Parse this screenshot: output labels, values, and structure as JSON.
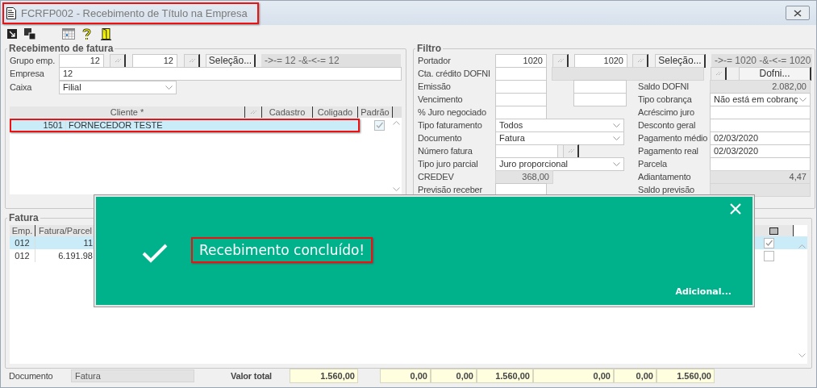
{
  "window": {
    "title": "FCRFP002 - Recebimento de Título na Empresa"
  },
  "recebimento": {
    "legend": "Recebimento de fatura",
    "grupo": {
      "label": "Grupo emp.",
      "from": "12",
      "to": "12",
      "button": "Seleção...",
      "filter": "->-= 12 -&-<-= 12"
    },
    "empresa": {
      "label": "Empresa",
      "value": "12"
    },
    "caixa": {
      "label": "Caixa",
      "value": "Filial"
    },
    "columns": [
      "Cliente *",
      "Cadastro",
      "Coligado",
      "Padrão"
    ],
    "rows": [
      {
        "code": "1501",
        "name": "FORNECEDOR TESTE",
        "padrao": true,
        "selected": true
      }
    ]
  },
  "filtro": {
    "legend": "Filtro",
    "rows": [
      {
        "label": "Portador",
        "kind": "range",
        "from": "1020",
        "to": "1020",
        "button": "Seleção...",
        "filter": "->-= 1020 -&-<-= 1020"
      },
      {
        "label": "Cta. crédito DOFNI",
        "kind": "account",
        "button": "Dofni..."
      },
      {
        "label": "Emissão",
        "kind": "pair",
        "right": {
          "label": "Saldo DOFNI",
          "kind": "readonly",
          "value": "2.082,00"
        }
      },
      {
        "label": "Vencimento",
        "kind": "pair",
        "right": {
          "label": "Tipo cobrança",
          "kind": "select",
          "value": "Não está em cobranç"
        }
      },
      {
        "label": "% Juro negociado",
        "kind": "input",
        "right": {
          "label": "Acréscimo juro",
          "kind": "input"
        }
      },
      {
        "label": "Tipo faturamento",
        "kind": "select",
        "value": "Todos",
        "right": {
          "label": "Desconto geral",
          "kind": "input"
        }
      },
      {
        "label": "Documento",
        "kind": "select",
        "value": "Fatura",
        "right": {
          "label": "Pagamento médio",
          "kind": "input",
          "value": "02/03/2020"
        }
      },
      {
        "label": "Número fatura",
        "kind": "lookup",
        "right": {
          "label": "Pagamento real",
          "kind": "input",
          "value": "02/03/2020"
        }
      },
      {
        "label": "Tipo juro parcial",
        "kind": "select",
        "value": "Juro proporcional",
        "right": {
          "label": "Parcela",
          "kind": "input"
        }
      },
      {
        "label": "CREDEV",
        "kind": "readonly",
        "value": "368,00",
        "right": {
          "label": "Adiantamento",
          "kind": "readonly",
          "value": "4,47"
        }
      },
      {
        "label": "Previsão receber",
        "kind": "input",
        "right": {
          "label": "Saldo previsão",
          "kind": "readonly"
        }
      }
    ]
  },
  "fatura": {
    "legend": "Fatura",
    "columns": [
      "Emp.",
      "Fatura/Parcel"
    ],
    "rows": [
      {
        "emp": "012",
        "fatura": "11",
        "checked": true,
        "selected": true
      },
      {
        "emp": "012",
        "fatura": "6.191.98",
        "checked": false,
        "selected": false
      }
    ]
  },
  "footer": {
    "documento_label": "Documento",
    "documento": "Fatura",
    "total_label": "Valor total",
    "total": "1.560,00",
    "values": [
      "0,00",
      "0,00",
      "1.560,00",
      "0,00",
      "0,00",
      "1.560,00"
    ]
  },
  "toast": {
    "message": "Recebimento concluído!",
    "link": "Adicional..."
  }
}
